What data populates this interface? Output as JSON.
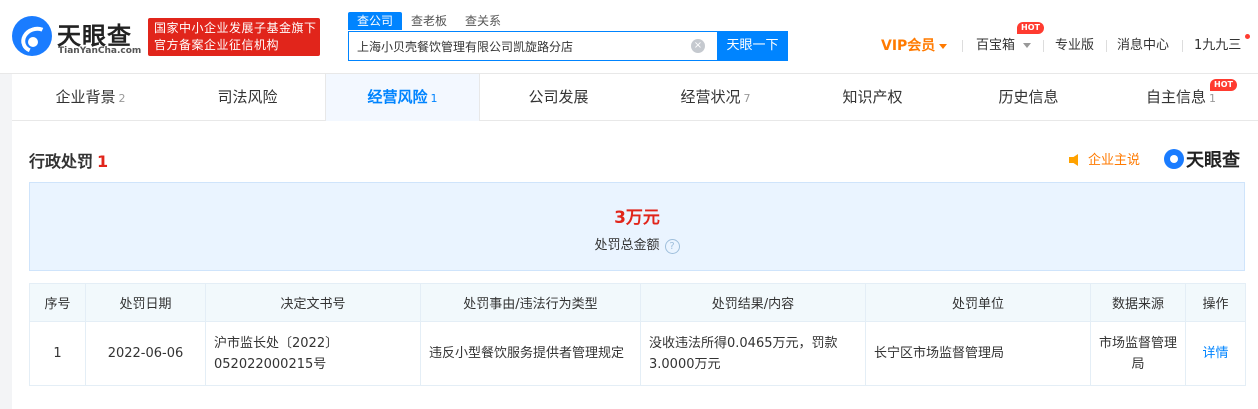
{
  "header": {
    "logo_name": "天眼查",
    "logo_sub": "TianYanCha.com",
    "gov_badge_line1": "国家中小企业发展子基金旗下",
    "gov_badge_line2": "官方备案企业征信机构",
    "search_tabs": [
      "查公司",
      "查老板",
      "查关系"
    ],
    "search_value": "上海小贝壳餐饮管理有限公司凯旋路分店",
    "search_button": "天眼一下",
    "clear_icon": "×",
    "vip": "VIP会员",
    "treasure": "百宝箱",
    "hot": "HOT",
    "pro": "专业版",
    "messages": "消息中心",
    "user": "1九九三"
  },
  "tabs": [
    {
      "label": "企业背景",
      "count": "2"
    },
    {
      "label": "司法风险",
      "count": ""
    },
    {
      "label": "经营风险",
      "count": "1"
    },
    {
      "label": "公司发展",
      "count": ""
    },
    {
      "label": "经营状况",
      "count": "7"
    },
    {
      "label": "知识产权",
      "count": ""
    },
    {
      "label": "历史信息",
      "count": ""
    },
    {
      "label": "自主信息",
      "count": "1"
    }
  ],
  "section": {
    "title": "行政处罚",
    "count": "1",
    "company_says": "企业主说",
    "brand": "天眼查"
  },
  "summary": {
    "amount": "3万元",
    "label": "处罚总金额",
    "help": "?"
  },
  "table": {
    "headers": [
      "序号",
      "处罚日期",
      "决定文书号",
      "处罚事由/违法行为类型",
      "处罚结果/内容",
      "处罚单位",
      "数据来源",
      "操作"
    ],
    "rows": [
      {
        "index": "1",
        "date": "2022-06-06",
        "doc_no": "沪市监长处〔2022〕052022000215号",
        "reason": "违反小型餐饮服务提供者管理规定",
        "result": "没收违法所得0.0465万元，罚款3.0000万元",
        "unit": "长宁区市场监督管理局",
        "source": "市场监督管理局",
        "action": "详情"
      }
    ]
  },
  "colors": {
    "brand_blue": "#0084ff",
    "red": "#e1251b",
    "vip_orange": "#ff7a00"
  }
}
